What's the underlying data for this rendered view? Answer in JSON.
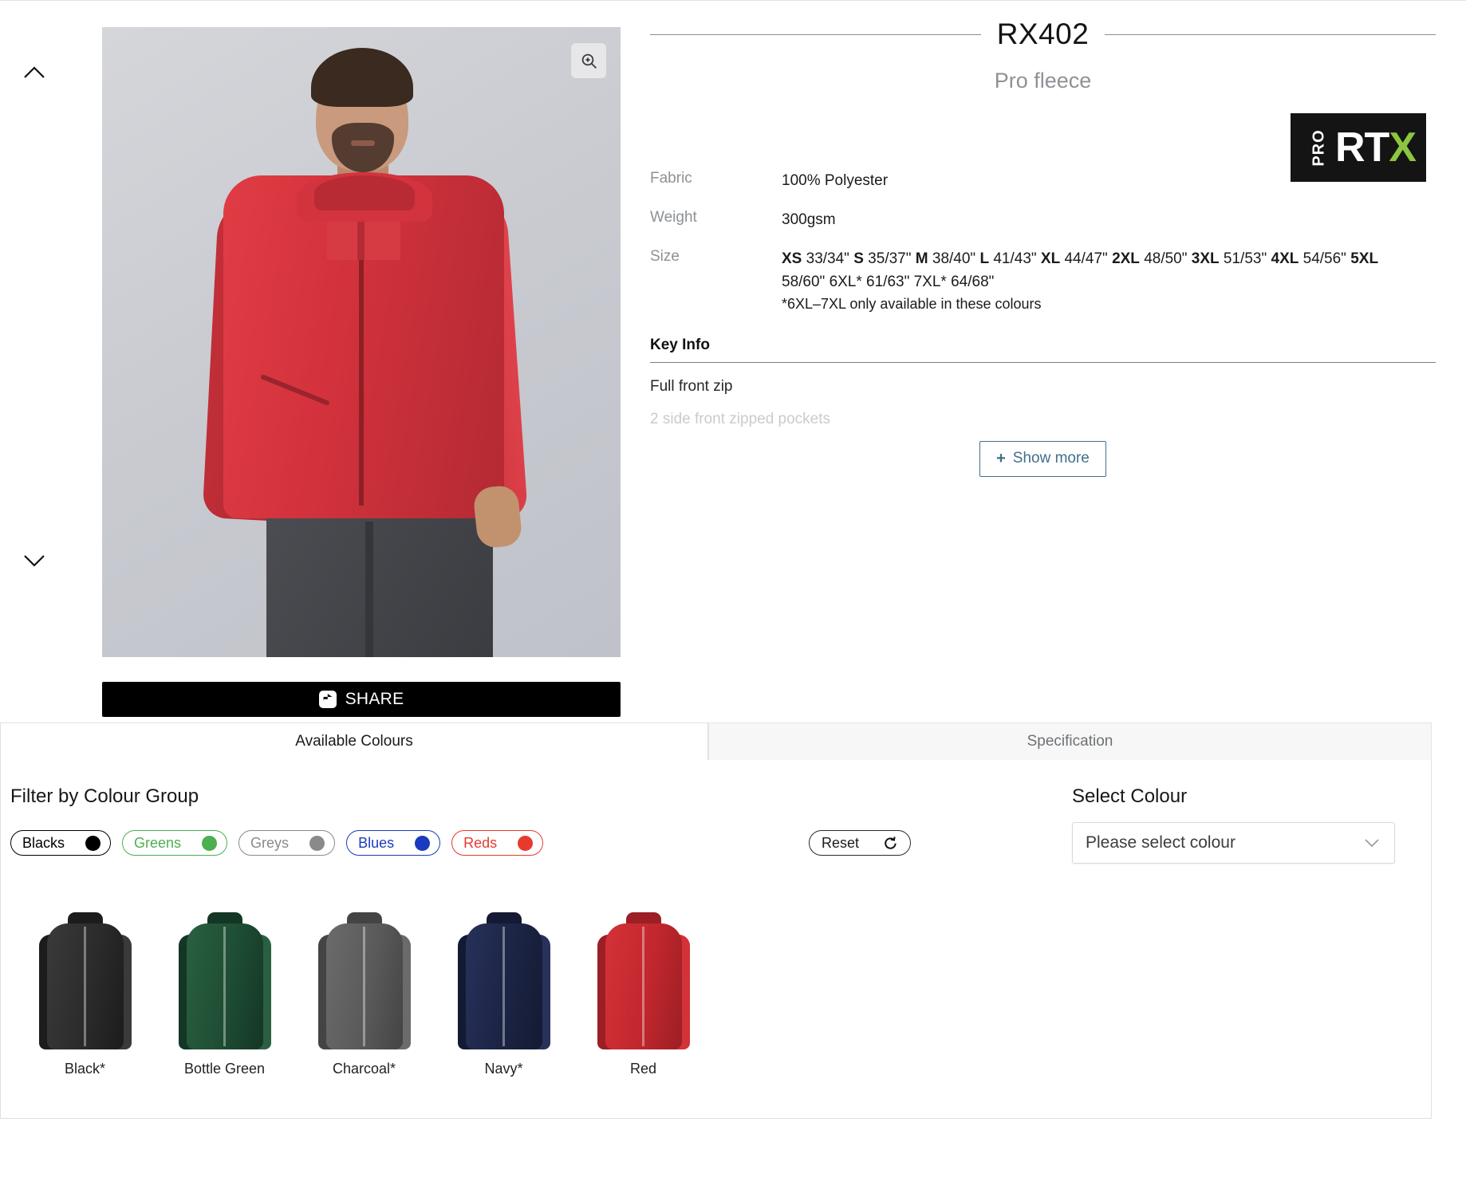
{
  "gallery": {
    "prev_label": "Previous image",
    "next_label": "Next image",
    "zoom_label": "Zoom image",
    "share_label": "SHARE"
  },
  "product": {
    "code": "RX402",
    "name": "Pro fleece",
    "brand_pro": "PRO",
    "brand_rt": "RT",
    "brand_x": "X",
    "specs": [
      {
        "label": "Fabric",
        "value": "100% Polyester"
      },
      {
        "label": "Weight",
        "value": "300gsm"
      }
    ],
    "size_label": "Size",
    "size_value": "XS 33/34\" S 35/37\" M 38/40\" L 41/43\" XL 44/47\" 2XL 48/50\" 3XL 51/53\" 4XL 54/56\" 5XL 58/60\" 6XL* 61/63\" 7XL* 64/68\"",
    "size_note": "*6XL–7XL only available in these colours",
    "key_info_heading": "Key Info",
    "key_info": [
      "Full front zip",
      "2 side front zipped pockets"
    ],
    "show_more_label": "Show more",
    "show_more_plus": "+"
  },
  "tabs": [
    {
      "label": "Available Colours",
      "active": true
    },
    {
      "label": "Specification",
      "active": false
    }
  ],
  "filter": {
    "heading": "Filter by Colour Group",
    "groups": [
      {
        "label": "Blacks",
        "color": "#000000"
      },
      {
        "label": "Greens",
        "color": "#4CAF50"
      },
      {
        "label": "Greys",
        "color": "#8a8a8a"
      },
      {
        "label": "Blues",
        "color": "#1a3bbf"
      },
      {
        "label": "Reds",
        "color": "#e8392f"
      }
    ],
    "reset_label": "Reset"
  },
  "select_colour": {
    "heading": "Select Colour",
    "placeholder": "Please select colour",
    "value": "Please select colour"
  },
  "colours": [
    {
      "label": "Black*",
      "body": "#2b2b2b",
      "shade": "#1c1c1c",
      "light": "#3a3a3a"
    },
    {
      "label": "Bottle Green",
      "body": "#1e4d33",
      "shade": "#143626",
      "light": "#2a6041"
    },
    {
      "label": "Charcoal*",
      "body": "#5a5a5a",
      "shade": "#444444",
      "light": "#6b6b6b"
    },
    {
      "label": "Navy*",
      "body": "#1c2444",
      "shade": "#141a33",
      "light": "#27315a"
    },
    {
      "label": "Red",
      "body": "#c1272d",
      "shade": "#9b1f24",
      "light": "#d33238"
    }
  ]
}
